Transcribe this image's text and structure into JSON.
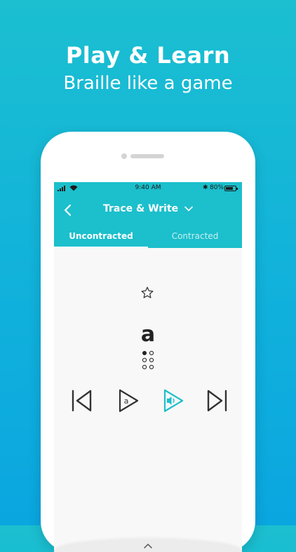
{
  "marketing": {
    "headline": "Play & Learn",
    "subline": "Braille like a game"
  },
  "status_bar": {
    "time": "9:40 AM",
    "battery_percent": "80%",
    "battery_level": 0.8
  },
  "nav": {
    "title": "Trace & Write",
    "back_icon": "chevron-left-icon",
    "dropdown_icon": "chevron-down-icon"
  },
  "tabs": [
    {
      "label": "Uncontracted",
      "active": true
    },
    {
      "label": "Contracted",
      "active": false
    }
  ],
  "lesson": {
    "letter": "a",
    "braille_dots_filled": [
      1
    ],
    "favorite_icon": "star-outline-icon"
  },
  "controls": [
    {
      "icon": "skip-previous-icon"
    },
    {
      "icon": "play-letter-icon",
      "glyph": "a"
    },
    {
      "icon": "play-sound-icon"
    },
    {
      "icon": "skip-next-icon"
    }
  ],
  "colors": {
    "accent": "#1cbfcc",
    "background_gradient_top": "#1bbfd0",
    "background_gradient_bottom": "#0aa6e0",
    "icon_dark": "#333333"
  }
}
